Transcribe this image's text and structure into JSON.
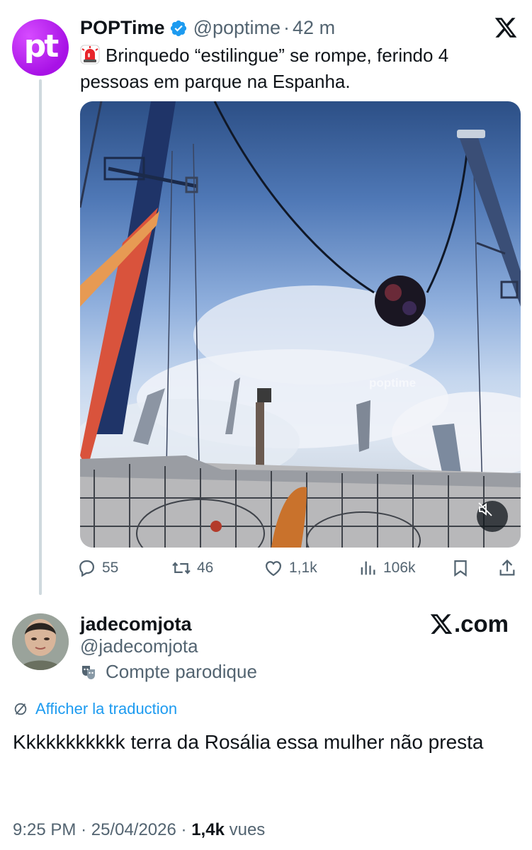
{
  "quoted_tweet": {
    "avatar_text": "pt",
    "name": "POPTime",
    "handle": "@poptime",
    "separator": "·",
    "time": "42 m",
    "text": "Brinquedo “estilingue” se rompe, ferindo 4 pessoas em parque na Espanha.",
    "media_watermark": "poptime",
    "actions": {
      "replies": "55",
      "reposts": "46",
      "likes": "1,1k",
      "views": "106k"
    }
  },
  "tweet": {
    "name": "jadecomjota",
    "handle": "@jadecomjota",
    "parody_label": "Compte parodique",
    "site_label": ".com",
    "translate_label": "Afficher la traduction",
    "text": "Kkkkkkkkkkk terra da Rosália essa mulher não presta",
    "time": "9:25 PM",
    "sep1": "·",
    "date": "25/04/2026",
    "sep2": "·",
    "views": "1,4k",
    "views_label": "vues"
  },
  "colors": {
    "brand_purple": "#b81cf0",
    "verified_blue": "#1d9bf0",
    "link_blue": "#1d9bf0",
    "secondary_text": "#536471"
  }
}
